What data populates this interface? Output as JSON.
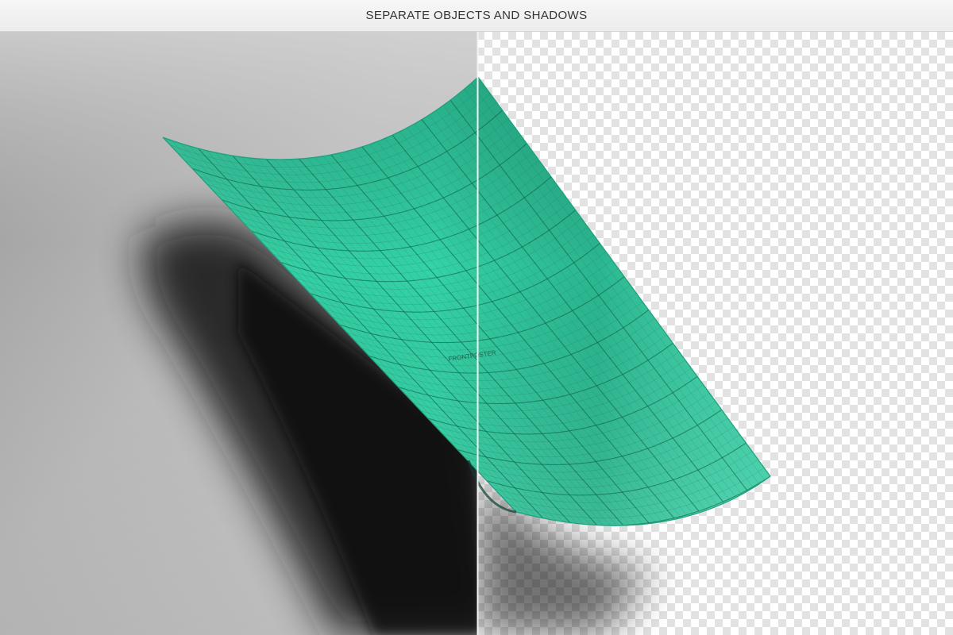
{
  "header": {
    "title": "SEPARATE OBJECTS AND SHADOWS"
  },
  "poster": {
    "label": "FRONTPOSTER",
    "color": "#33d1a5"
  },
  "panels": {
    "left": "shadow-background",
    "right": "transparency-checkerboard"
  }
}
